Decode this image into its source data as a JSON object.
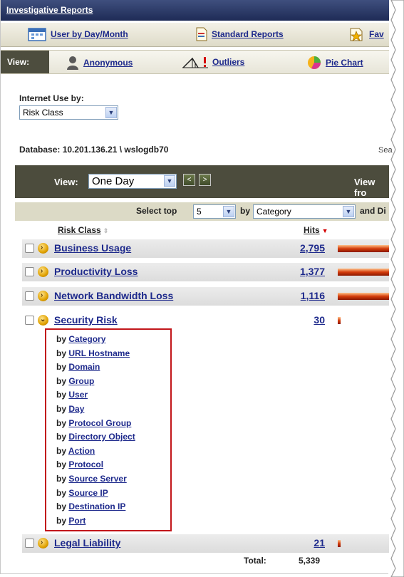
{
  "title": "Investigative Reports",
  "tabs": [
    {
      "label": "User by Day/Month",
      "icon": "calendar-icon"
    },
    {
      "label": "Standard Reports",
      "icon": "document-icon"
    },
    {
      "label": "Fav",
      "icon": "favorites-icon"
    }
  ],
  "view_bar": {
    "label": "View:",
    "options": [
      {
        "label": "Anonymous",
        "icon": "user-silhouette-icon"
      },
      {
        "label": "Outliers",
        "icon": "outliers-chart-icon"
      },
      {
        "label": "Pie Chart",
        "icon": "pie-chart-icon"
      }
    ]
  },
  "internet_use": {
    "label": "Internet Use by:",
    "selected": "Risk Class"
  },
  "database": {
    "text": "Database:  10.201.136.21 \\ wslogdb70",
    "search_partial": "Sea"
  },
  "period": {
    "label": "View:",
    "selected": "One Day",
    "prev": "<",
    "next": ">",
    "view_from": "View fro"
  },
  "select_top": {
    "label": "Select top",
    "value": "5",
    "by_label": "by",
    "by_value": "Category",
    "and_label": "and Di"
  },
  "columns": {
    "name": "Risk Class",
    "hits": "Hits"
  },
  "rows": [
    {
      "name": "Business Usage",
      "hits": "2,795",
      "bar_fraction": 1.0
    },
    {
      "name": "Productivity Loss",
      "hits": "1,377",
      "bar_fraction": 1.0
    },
    {
      "name": "Network Bandwidth Loss",
      "hits": "1,116",
      "bar_fraction": 1.0
    },
    {
      "name": "Security Risk",
      "hits": "30",
      "bar_fraction": 0.02
    },
    {
      "name": "Legal Liability",
      "hits": "21",
      "bar_fraction": 0.01
    }
  ],
  "drilldown": {
    "prefix": "by",
    "items": [
      "Category",
      "URL Hostname",
      "Domain",
      "Group",
      "User",
      "Day",
      "Protocol Group",
      "Directory Object",
      "Action",
      "Protocol",
      "Source Server",
      "Source IP",
      "Destination IP",
      "Port"
    ]
  },
  "total": {
    "label": "Total:",
    "value": "5,339"
  }
}
